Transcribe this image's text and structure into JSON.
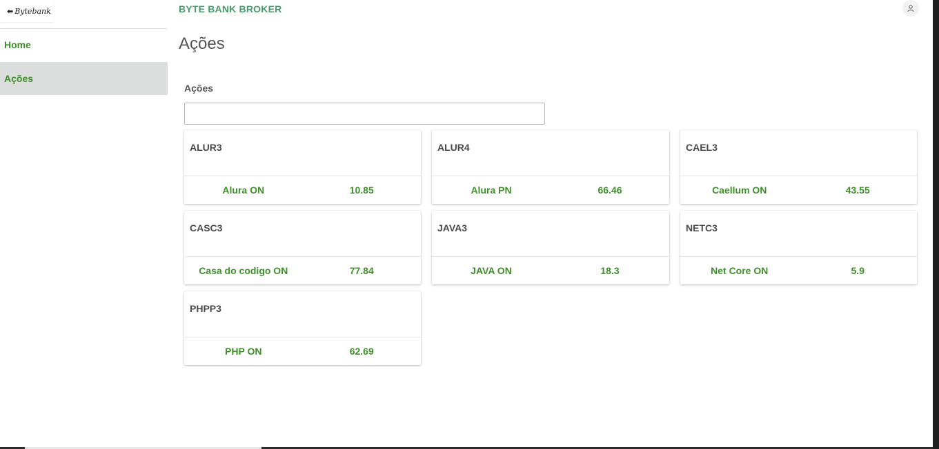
{
  "brand": {
    "logo_text": "Bytebank",
    "app_title": "BYTE BANK BROKER"
  },
  "sidebar": {
    "items": [
      {
        "label": "Home",
        "active": false
      },
      {
        "label": "Ações",
        "active": true
      }
    ]
  },
  "header": {
    "user_icon": "user-icon"
  },
  "main": {
    "page_title": "Ações",
    "search": {
      "label": "Ações",
      "value": "",
      "placeholder": ""
    },
    "stocks": [
      {
        "code": "ALUR3",
        "name": "Alura ON",
        "value": "10.85"
      },
      {
        "code": "ALUR4",
        "name": "Alura PN",
        "value": "66.46"
      },
      {
        "code": "CAEL3",
        "name": "Caellum ON",
        "value": "43.55"
      },
      {
        "code": "CASC3",
        "name": "Casa do codigo ON",
        "value": "77.84"
      },
      {
        "code": "JAVA3",
        "name": "JAVA ON",
        "value": "18.3"
      },
      {
        "code": "NETC3",
        "name": "Net Core ON",
        "value": "5.9"
      },
      {
        "code": "PHPP3",
        "name": "PHP ON",
        "value": "62.69"
      }
    ]
  },
  "colors": {
    "accent_green": "#3f8e2c",
    "brand_teal": "#4a9a6f",
    "active_nav_bg": "#dcdedd"
  }
}
